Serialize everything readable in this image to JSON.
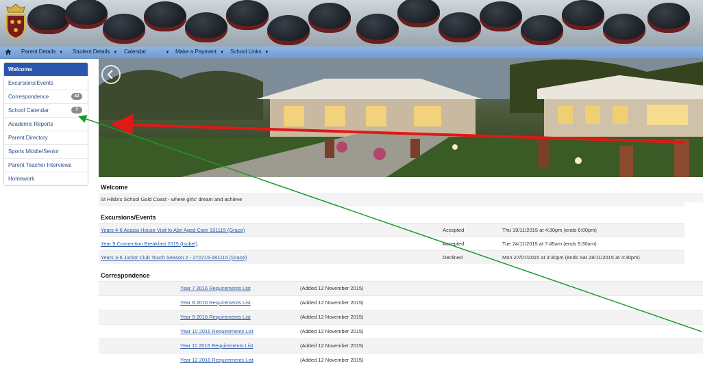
{
  "navbar": {
    "items": [
      {
        "label": "Parent Details",
        "has_caret": true
      },
      {
        "label": "Student Details",
        "has_caret": true
      },
      {
        "label": "Calendar",
        "has_caret": true
      },
      {
        "label": "Make a Payment",
        "has_caret": true
      },
      {
        "label": "School Links",
        "has_caret": true
      }
    ],
    "color": "#8fb6e4"
  },
  "sidebar": {
    "items": [
      {
        "label": "Welcome",
        "active": true
      },
      {
        "label": "Excursions/Events"
      },
      {
        "label": "Correspondence",
        "badge": "42"
      },
      {
        "label": "School Calendar",
        "badge": "7"
      },
      {
        "label": "Academic Reports"
      },
      {
        "label": "Parent Directory"
      },
      {
        "label": "Sports Middle/Senior"
      },
      {
        "label": "Parent Teacher Interviews"
      },
      {
        "label": "Homework"
      }
    ],
    "active_color": "#2a56b0"
  },
  "welcome": {
    "title": "Welcome",
    "text": "St Hilda's School Gold Coast - where girls' dream and achieve"
  },
  "excursions": {
    "title": "Excursions/Events",
    "rows": [
      {
        "name": "Years 4-6 Acacia House Visit to Abri Aged Care 191115 (Grace)",
        "status": "Accepted",
        "date": "Thu 19/11/2015 at 4:30pm (ends 6:00pm)"
      },
      {
        "name": "Year 9 Connection Breakfast 2015 (Isobel)",
        "status": "Accepted",
        "date": "Tue 24/11/2015 at 7:45am (ends 9:30am)"
      },
      {
        "name": "Years 3-6 Junior Club Touch Season 2 - 270715-281115 (Grace)",
        "status": "Declined",
        "date": "Mon 27/07/2015 at 3:30pm (ends Sat 28/11/2015 at 4:30pm)"
      }
    ]
  },
  "correspondence": {
    "title": "Correspondence",
    "rows": [
      {
        "name": "Year 7 2016 Requirements List",
        "added": "(Added 12 November 2015)"
      },
      {
        "name": "Year 8 2016 Requirements List",
        "added": "(Added 12 November 2015)"
      },
      {
        "name": "Year 9 2016 Requirements List",
        "added": "(Added 12 November 2015)"
      },
      {
        "name": "Year 10 2016 Requirements List",
        "added": "(Added 12 November 2015)"
      },
      {
        "name": "Year 11 2016 Requirements List",
        "added": "(Added 12 November 2015)"
      },
      {
        "name": "Year 12 2016 Requirements List",
        "added": "(Added 12 November 2015)"
      }
    ]
  },
  "icons": {
    "home": "home-icon",
    "hero_prev": "chevron-left-icon",
    "crest": "school-crest-icon"
  },
  "annotations": {
    "red_arrow_color": "#e01818",
    "green_arrow_color": "#1a9a2a"
  }
}
